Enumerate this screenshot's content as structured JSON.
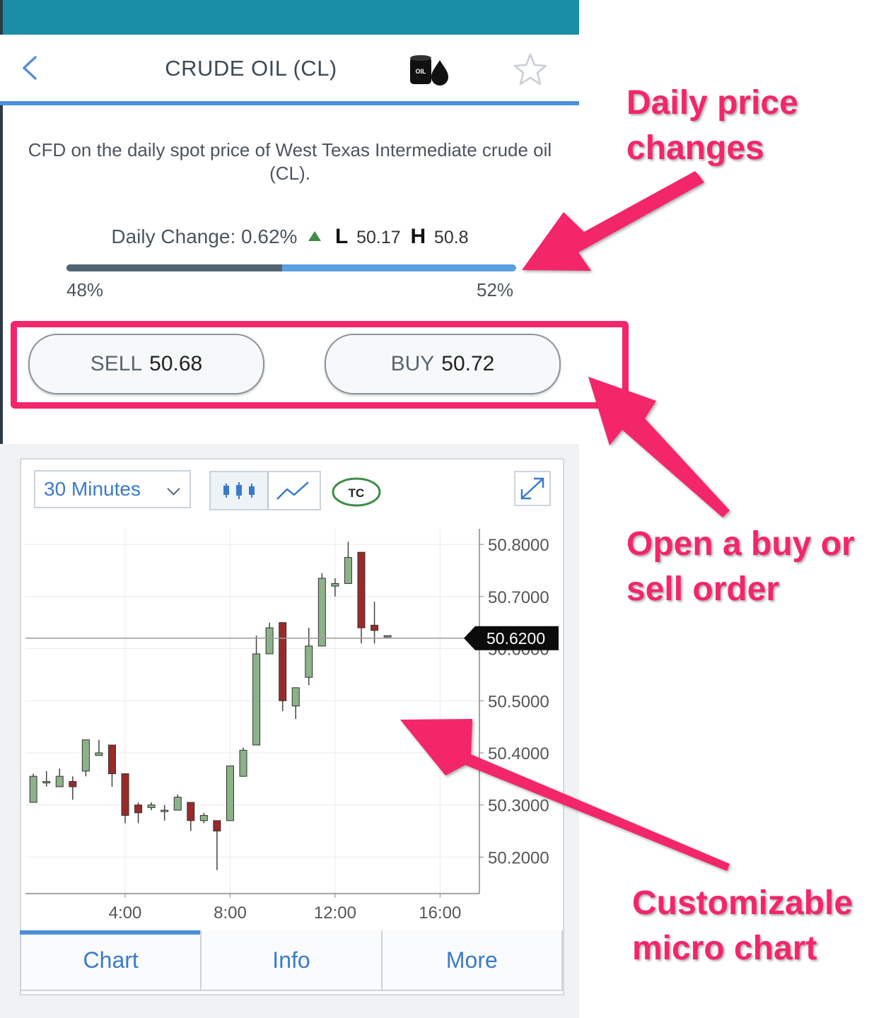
{
  "header": {
    "title": "CRUDE OIL (CL)",
    "instrument_icon": "oil-barrel-icon",
    "icon_text": "OIL"
  },
  "description": "CFD on the daily spot price of West Texas Intermediate crude oil (CL).",
  "daily_change": {
    "label": "Daily Change:",
    "value": "0.62%",
    "direction": "up",
    "low_label": "L",
    "low": "50.17",
    "high_label": "H",
    "high": "50.8",
    "sentiment_sell": 0.48,
    "sell_pct": "48%",
    "buy_pct": "52%"
  },
  "trade": {
    "sell_label": "SELL",
    "sell_price": "50.68",
    "buy_label": "BUY",
    "buy_price": "50.72"
  },
  "chart_toolbar": {
    "interval": "30 Minutes",
    "tc_label": "TC"
  },
  "chart_data": {
    "type": "candlestick",
    "x_ticks": [
      "4:00",
      "8:00",
      "12:00",
      "16:00"
    ],
    "x_tick_hours": [
      4,
      8,
      12,
      16
    ],
    "x_range_hours": [
      0.2,
      17.5
    ],
    "y_ticks": [
      "50.8000",
      "50.7000",
      "50.6000",
      "50.5000",
      "50.4000",
      "50.3000",
      "50.2000"
    ],
    "y_tick_values": [
      50.8,
      50.7,
      50.6,
      50.5,
      50.4,
      50.3,
      50.2
    ],
    "ylim": [
      50.13,
      50.83
    ],
    "current_price": "50.6200",
    "current_value": 50.62,
    "candles": [
      {
        "t": 0.5,
        "o": 50.305,
        "h": 50.36,
        "l": 50.305,
        "c": 50.355
      },
      {
        "t": 1.0,
        "o": 50.345,
        "h": 50.365,
        "l": 50.335,
        "c": 50.345
      },
      {
        "t": 1.5,
        "o": 50.335,
        "h": 50.37,
        "l": 50.335,
        "c": 50.355
      },
      {
        "t": 2.0,
        "o": 50.345,
        "h": 50.355,
        "l": 50.31,
        "c": 50.335
      },
      {
        "t": 2.5,
        "o": 50.365,
        "h": 50.425,
        "l": 50.355,
        "c": 50.425
      },
      {
        "t": 3.0,
        "o": 50.395,
        "h": 50.425,
        "l": 50.395,
        "c": 50.4
      },
      {
        "t": 3.5,
        "o": 50.415,
        "h": 50.415,
        "l": 50.335,
        "c": 50.36
      },
      {
        "t": 4.0,
        "o": 50.36,
        "h": 50.36,
        "l": 50.265,
        "c": 50.28
      },
      {
        "t": 4.5,
        "o": 50.3,
        "h": 50.305,
        "l": 50.265,
        "c": 50.285
      },
      {
        "t": 5.0,
        "o": 50.295,
        "h": 50.305,
        "l": 50.29,
        "c": 50.3
      },
      {
        "t": 5.5,
        "o": 50.29,
        "h": 50.3,
        "l": 50.27,
        "c": 50.29
      },
      {
        "t": 6.0,
        "o": 50.29,
        "h": 50.32,
        "l": 50.29,
        "c": 50.315
      },
      {
        "t": 6.5,
        "o": 50.305,
        "h": 50.305,
        "l": 50.25,
        "c": 50.27
      },
      {
        "t": 7.0,
        "o": 50.27,
        "h": 50.285,
        "l": 50.265,
        "c": 50.28
      },
      {
        "t": 7.5,
        "o": 50.27,
        "h": 50.27,
        "l": 50.175,
        "c": 50.25
      },
      {
        "t": 8.0,
        "o": 50.27,
        "h": 50.375,
        "l": 50.27,
        "c": 50.375
      },
      {
        "t": 8.5,
        "o": 50.355,
        "h": 50.41,
        "l": 50.355,
        "c": 50.405
      },
      {
        "t": 9.0,
        "o": 50.415,
        "h": 50.625,
        "l": 50.415,
        "c": 50.59
      },
      {
        "t": 9.5,
        "o": 50.59,
        "h": 50.65,
        "l": 50.59,
        "c": 50.64
      },
      {
        "t": 10.0,
        "o": 50.65,
        "h": 50.65,
        "l": 50.48,
        "c": 50.5
      },
      {
        "t": 10.5,
        "o": 50.49,
        "h": 50.52,
        "l": 50.465,
        "c": 50.525
      },
      {
        "t": 11.0,
        "o": 50.545,
        "h": 50.64,
        "l": 50.53,
        "c": 50.605
      },
      {
        "t": 11.5,
        "o": 50.605,
        "h": 50.745,
        "l": 50.605,
        "c": 50.735
      },
      {
        "t": 12.0,
        "o": 50.72,
        "h": 50.735,
        "l": 50.7,
        "c": 50.725
      },
      {
        "t": 12.5,
        "o": 50.725,
        "h": 50.805,
        "l": 50.725,
        "c": 50.775
      },
      {
        "t": 13.0,
        "o": 50.785,
        "h": 50.785,
        "l": 50.61,
        "c": 50.64
      },
      {
        "t": 13.5,
        "o": 50.645,
        "h": 50.69,
        "l": 50.61,
        "c": 50.635
      },
      {
        "t": 14.0,
        "o": 50.625,
        "h": 50.625,
        "l": 50.625,
        "c": 50.625
      }
    ],
    "up_color": "#8db28a",
    "down_color": "#9a2a2a"
  },
  "tabs": [
    {
      "label": "Chart",
      "active": true
    },
    {
      "label": "Info",
      "active": false
    },
    {
      "label": "More",
      "active": false
    }
  ],
  "annotations": {
    "daily": "Daily price\nchanges",
    "order": "Open a buy or\nsell order",
    "chart": "Customizable\nmicro chart",
    "color": "#f3266a"
  }
}
